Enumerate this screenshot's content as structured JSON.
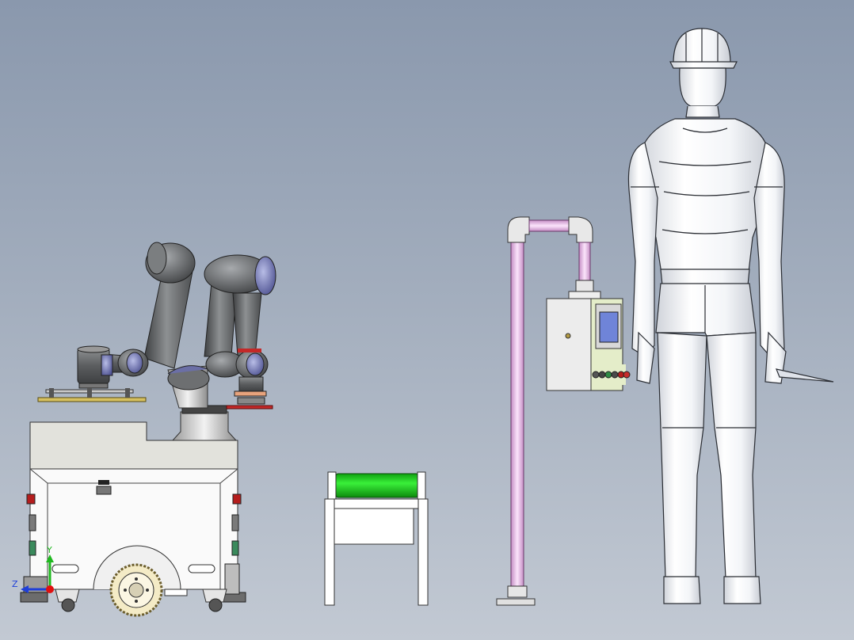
{
  "view": {
    "background_top": "#8a98ad",
    "background_bottom": "#c2c9d3",
    "triad": {
      "y_label": "Y",
      "z_label": "Z",
      "x_color": "#e01010",
      "y_color": "#1fb81f",
      "z_color": "#1f3fd8"
    }
  },
  "colors": {
    "robot_dark": "#5a5c5e",
    "robot_cap": "#6b6fa6",
    "roller_green": "#22d022",
    "pipe_pink": "#e6b6e6",
    "panel_body": "#e9e9e9",
    "panel_face": "#e4edc9",
    "screen_blue": "#6f84d8",
    "plate_yellow": "#d6c060",
    "plate_red": "#c42828"
  }
}
